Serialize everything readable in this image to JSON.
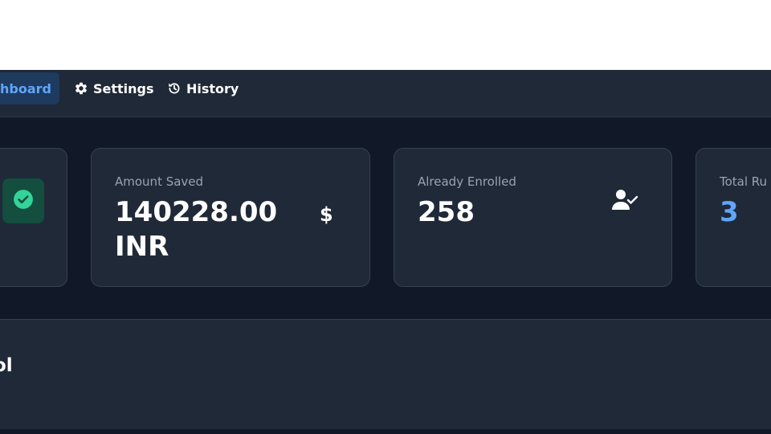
{
  "nav": {
    "dashboard_label": "shboard",
    "settings_label": "Settings",
    "history_label": "History"
  },
  "stats": {
    "amount_saved": {
      "label": "Amount Saved",
      "value": "140228.00 INR"
    },
    "already_enrolled": {
      "label": "Already Enrolled",
      "value": "258"
    },
    "total_runs": {
      "label": "Total Ru",
      "value": "3"
    }
  },
  "panel": {
    "title": "ol"
  },
  "colors": {
    "accent": "#60a5fa",
    "success": "#34d399",
    "background": "#111827",
    "card": "#1f2937"
  },
  "icons": [
    "gear-icon",
    "history-icon",
    "check-circle-icon",
    "dollar-icon",
    "user-check-icon"
  ]
}
